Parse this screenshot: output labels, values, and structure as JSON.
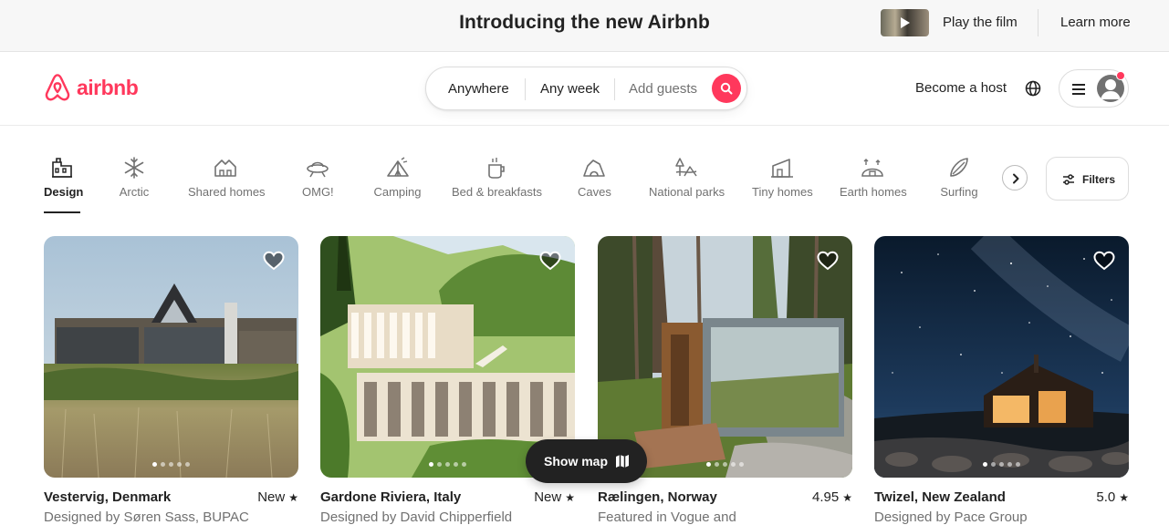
{
  "banner": {
    "title": "Introducing the new Airbnb",
    "play_film": "Play the film",
    "learn_more": "Learn more"
  },
  "header": {
    "logo_text": "airbnb",
    "brand_color": "#ff385c",
    "search": {
      "where": "Anywhere",
      "when": "Any week",
      "guests_placeholder": "Add guests"
    },
    "become_host": "Become a host"
  },
  "categories": [
    {
      "label": "Design",
      "icon": "design-icon",
      "active": true
    },
    {
      "label": "Arctic",
      "icon": "snowflake-icon"
    },
    {
      "label": "Shared homes",
      "icon": "shared-homes-icon"
    },
    {
      "label": "OMG!",
      "icon": "ufo-icon"
    },
    {
      "label": "Camping",
      "icon": "tent-icon"
    },
    {
      "label": "Bed & breakfasts",
      "icon": "coffee-icon"
    },
    {
      "label": "Caves",
      "icon": "cave-icon"
    },
    {
      "label": "National parks",
      "icon": "national-park-icon"
    },
    {
      "label": "Tiny homes",
      "icon": "tiny-home-icon"
    },
    {
      "label": "Earth homes",
      "icon": "earth-home-icon"
    },
    {
      "label": "Surfing",
      "icon": "surfboard-icon"
    }
  ],
  "filters_label": "Filters",
  "listings": [
    {
      "title": "Vestervig, Denmark",
      "rating": "New",
      "subtitle": "Designed by Søren Sass, BUPAC"
    },
    {
      "title": "Gardone Riviera, Italy",
      "rating": "New",
      "subtitle": "Designed by David Chipperfield"
    },
    {
      "title": "Rælingen, Norway",
      "rating": "4.95",
      "subtitle": "Featured in Vogue and"
    },
    {
      "title": "Twizel, New Zealand",
      "rating": "5.0",
      "subtitle": "Designed by Pace Group"
    }
  ],
  "show_map": "Show map"
}
